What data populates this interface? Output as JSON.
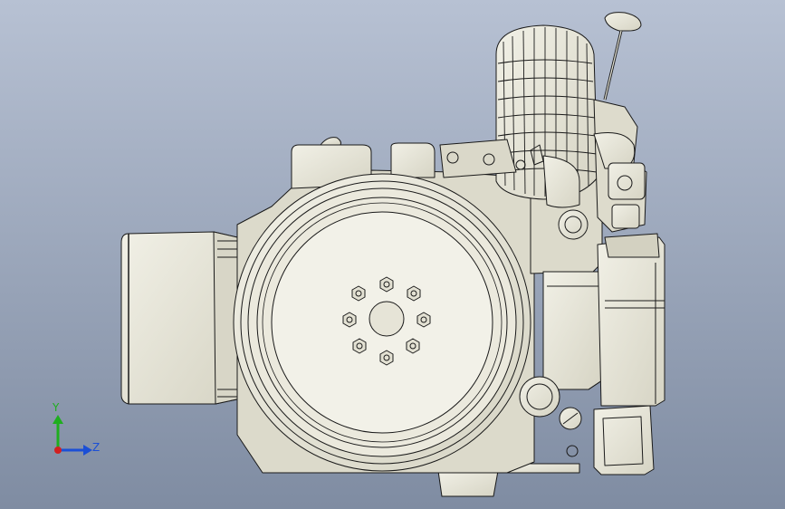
{
  "viewport": {
    "background_top": "#b7c1d3",
    "background_bottom": "#7f8ca2"
  },
  "model": {
    "name_icon": "engine-model",
    "body_color": "#e6e5d8",
    "shade_color": "#cfcdbd",
    "edge_color": "#1a1a1a"
  },
  "triad": {
    "y_label": "Y",
    "z_label": "Z",
    "y_color": "#1fae1f",
    "z_color": "#1b4fd6",
    "x_color": "#d22020"
  }
}
